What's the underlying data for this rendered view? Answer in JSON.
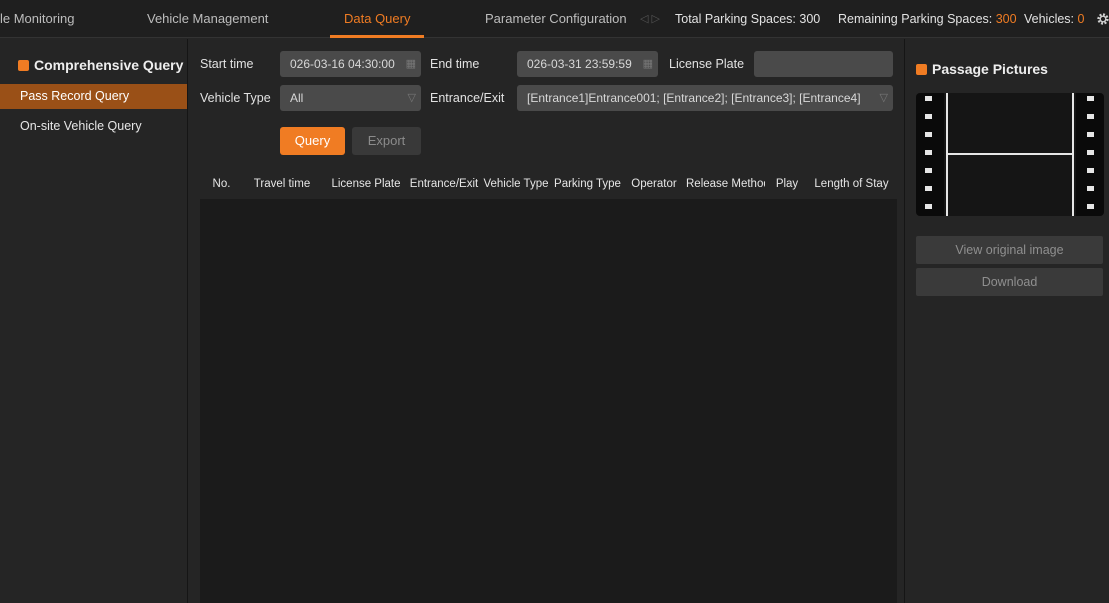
{
  "nav": {
    "tabs": [
      {
        "label": "le Monitoring"
      },
      {
        "label": "Vehicle Management"
      },
      {
        "label": "Data Query"
      },
      {
        "label": "Parameter Configuration"
      }
    ],
    "arrows": "◁ ▷"
  },
  "stats": {
    "total_label": "Total Parking Spaces:",
    "total_value": "300",
    "remaining_label": "Remaining Parking Spaces:",
    "remaining_value": "300",
    "vehicles_label": "Vehicles:",
    "vehicles_value": "0"
  },
  "sidebar": {
    "title": "Comprehensive Query",
    "items": [
      {
        "label": "Pass Record Query"
      },
      {
        "label": "On-site Vehicle Query"
      }
    ]
  },
  "form": {
    "start_label": "Start time",
    "start_value": "026-03-16 04:30:00",
    "end_label": "End time",
    "end_value": "026-03-31 23:59:59",
    "plate_label": "License Plate",
    "plate_value": "",
    "type_label": "Vehicle Type",
    "type_value": "All",
    "entrance_label": "Entrance/Exit",
    "entrance_value": "[Entrance1]Entrance001; [Entrance2]; [Entrance3]; [Entrance4]",
    "query_label": "Query",
    "export_label": "Export"
  },
  "table": {
    "columns": [
      "No.",
      "Travel time",
      "License Plate",
      "Entrance/Exit",
      "Vehicle Type",
      "Parking Type",
      "Operator",
      "Release Method",
      "Play",
      "Length of Stay"
    ],
    "rows": []
  },
  "right_panel": {
    "title": "Passage Pictures",
    "view_label": "View original image",
    "download_label": "Download"
  },
  "colors": {
    "accent": "#f07c23",
    "background": "#252525"
  }
}
